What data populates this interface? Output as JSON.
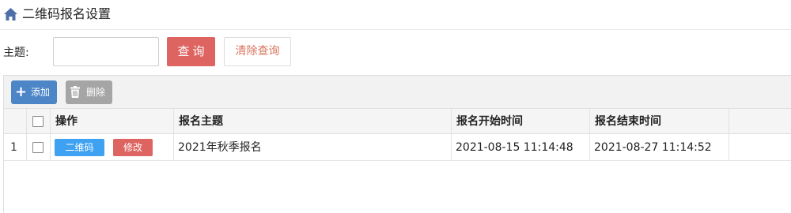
{
  "page": {
    "title": "二维码报名设置",
    "home_icon": "home-icon"
  },
  "search": {
    "label": "主题:",
    "value": "",
    "placeholder": "",
    "query_label": "查询",
    "clear_label": "清除查询"
  },
  "toolbar": {
    "add_label": "添加",
    "add_icon": "plus-icon",
    "delete_label": "删除",
    "delete_icon": "trash-icon"
  },
  "table": {
    "columns": [
      "操作",
      "报名主题",
      "报名开始时间",
      "报名结束时间"
    ],
    "rows": [
      {
        "index": "1",
        "checked": false,
        "actions": {
          "qr_label": "二维码",
          "edit_label": "修改"
        },
        "subject": "2021年秋季报名",
        "start_time": "2021-08-15 11:14:48",
        "end_time": "2021-08-27 11:14:52"
      }
    ]
  },
  "colors": {
    "query_button": "#dd6461",
    "add_button": "#4d86c6",
    "delete_button": "#a5a5a5",
    "qr_button": "#3fa1f1",
    "edit_button": "#dd6461",
    "clear_text": "#d8745c"
  }
}
